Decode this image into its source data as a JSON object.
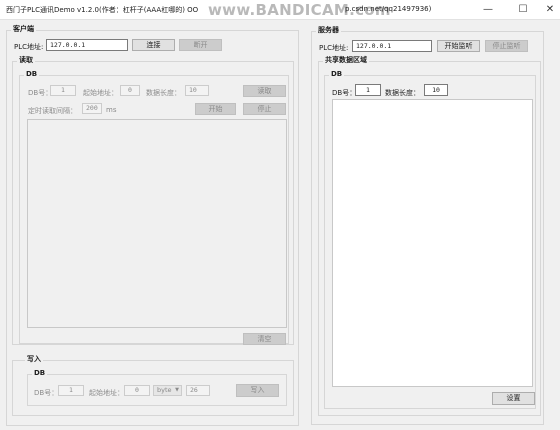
{
  "window": {
    "title": "西门子PLC通讯Demo v1.2.0(作者：杠杆子(AAA杠哪的) OO",
    "watermark": "www.BANDICAM.com",
    "title_url": "p.csdn.net/qq21497936)",
    "minimize_glyph": "—",
    "maximize_glyph": "☐",
    "close_glyph": "✕"
  },
  "client": {
    "section_label": "客户端",
    "plc_label": "PLC地址:",
    "plc_value": "127.0.0.1",
    "connect_label": "连接",
    "disconnect_label": "断开",
    "read": {
      "group_label": "读取",
      "db_group_label": "DB",
      "db_label": "DB号：",
      "db_value": "1",
      "start_label": "起始地址：",
      "start_value": "0",
      "length_label": "数据长度：",
      "length_value": "10",
      "read_button": "读取",
      "interval_label": "定时读取间隔：",
      "interval_value": "200",
      "interval_unit": "ms",
      "start_button": "开始",
      "stop_button": "停止",
      "clear_button": "清空"
    },
    "write": {
      "group_label": "写入",
      "db_group_label": "DB",
      "db_label": "DB号：",
      "db_value": "1",
      "start_label": "起始地址：",
      "start_value": "0",
      "type_value": "byte",
      "value": "26",
      "write_button": "写入"
    }
  },
  "server": {
    "section_label": "服务器",
    "plc_label": "PLC地址:",
    "plc_value": "127.0.0.1",
    "start_listen": "开始监听",
    "stop_listen": "停止监听",
    "shared_group_label": "共享数据区域",
    "db_group_label": "DB",
    "db_label": "DB号：",
    "db_value": "1",
    "length_label": "数据长度：",
    "length_value": "10",
    "set_button": "设置"
  }
}
